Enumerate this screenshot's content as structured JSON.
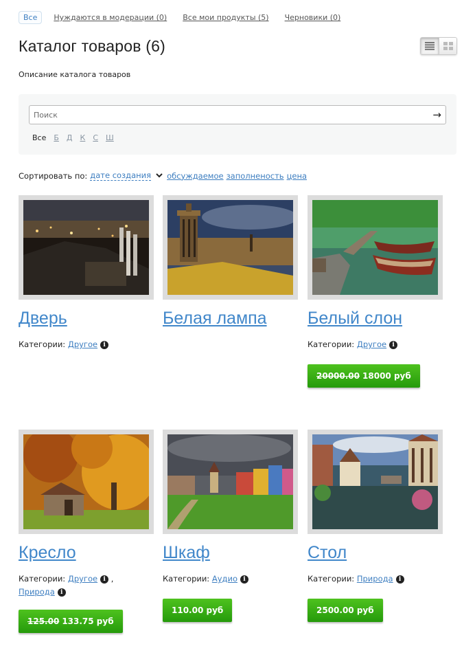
{
  "filters": {
    "all": "Все",
    "moderation": "Нуждаются в модерации (0)",
    "mine": "Все мои продукты (5)",
    "drafts": "Черновики (0)"
  },
  "page": {
    "title": "Каталог товаров (6)",
    "description": "Описание каталога товаров"
  },
  "view_toggle": {
    "list_icon": "list-view-icon",
    "grid_icon": "grid-view-icon",
    "active": "list"
  },
  "search": {
    "placeholder": "Поиск",
    "go_glyph": "→",
    "letters_all": "Все",
    "letters": [
      "Б",
      "Д",
      "К",
      "С",
      "Ш"
    ]
  },
  "sort": {
    "label": "Сортировать по:",
    "current": "дате создания",
    "options": [
      "обсуждаемое",
      "заполненость",
      "цена"
    ]
  },
  "categories_label": "Категории:",
  "products": [
    {
      "title": "Дверь",
      "image": "city-night-photo",
      "categories": [
        "Другое"
      ],
      "price": "",
      "old_price": ""
    },
    {
      "title": "Белая лампа",
      "image": "monument-city-view-photo",
      "categories": [],
      "price": "",
      "old_price": ""
    },
    {
      "title": "Белый слон",
      "image": "boats-lake-photo",
      "categories": [
        "Другое"
      ],
      "price": "18000 руб",
      "old_price": "20000.00"
    },
    {
      "title": "Кресло",
      "image": "autumn-hut-photo",
      "categories": [
        "Другое",
        "Природа"
      ],
      "price": "133.75 руб",
      "old_price": "125.00"
    },
    {
      "title": "Шкаф",
      "image": "colorful-village-photo",
      "categories": [
        "Аудио"
      ],
      "price": "110.00 руб",
      "old_price": ""
    },
    {
      "title": "Стол",
      "image": "canal-houses-photo",
      "categories": [
        "Природа"
      ],
      "price": "2500.00 руб",
      "old_price": ""
    }
  ],
  "colors": {
    "link": "#3d7ec0",
    "price_green": "#2ea10f",
    "thumb_frame": "#dcdcdc"
  }
}
